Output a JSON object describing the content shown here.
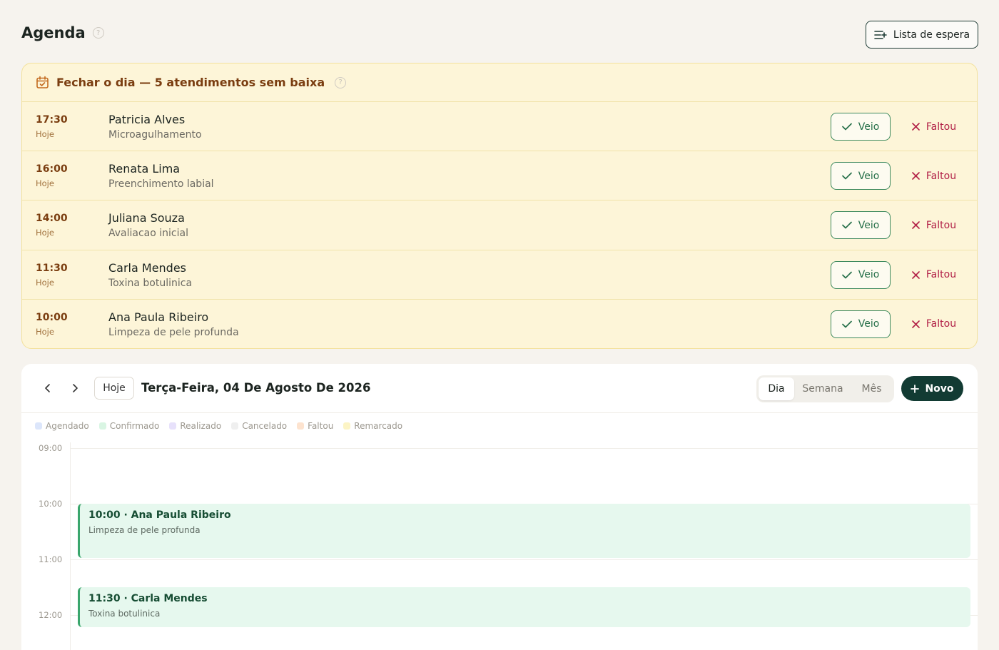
{
  "header": {
    "title": "Agenda",
    "help_glyph": "?",
    "waitlist_label": "Lista de espera"
  },
  "close_day": {
    "title": "Fechar o dia — 5 atendimentos sem baixa",
    "help_glyph": "?",
    "rows": [
      {
        "time": "17:30",
        "day": "Hoje",
        "client": "Patricia Alves",
        "service": "Microagulhamento",
        "yes_label": "Veio",
        "no_label": "Faltou"
      },
      {
        "time": "16:00",
        "day": "Hoje",
        "client": "Renata Lima",
        "service": "Preenchimento labial",
        "yes_label": "Veio",
        "no_label": "Faltou"
      },
      {
        "time": "14:00",
        "day": "Hoje",
        "client": "Juliana Souza",
        "service": "Avaliacao inicial",
        "yes_label": "Veio",
        "no_label": "Faltou"
      },
      {
        "time": "11:30",
        "day": "Hoje",
        "client": "Carla Mendes",
        "service": "Toxina botulinica",
        "yes_label": "Veio",
        "no_label": "Faltou"
      },
      {
        "time": "10:00",
        "day": "Hoje",
        "client": "Ana Paula Ribeiro",
        "service": "Limpeza de pele profunda",
        "yes_label": "Veio",
        "no_label": "Faltou"
      }
    ]
  },
  "calendar": {
    "today_label": "Hoje",
    "date_label": "Terça-Feira, 04 De Agosto De 2026",
    "views": [
      "Dia",
      "Semana",
      "Mês"
    ],
    "active_view": "Dia",
    "new_label": "Novo",
    "legend": [
      {
        "label": "Agendado",
        "color": "#dce6fb"
      },
      {
        "label": "Confirmado",
        "color": "#d9f5e3"
      },
      {
        "label": "Realizado",
        "color": "#e7e1fb"
      },
      {
        "label": "Cancelado",
        "color": "#efefef"
      },
      {
        "label": "Faltou",
        "color": "#fde3cf"
      },
      {
        "label": "Remarcado",
        "color": "#fcf4c5"
      }
    ],
    "hours": [
      "09:00",
      "10:00",
      "11:00",
      "12:00"
    ],
    "events": [
      {
        "title": "10:00 · Ana Paula Ribeiro",
        "subtitle": "Limpeza de pele profunda"
      },
      {
        "title": "11:30 · Carla Mendes",
        "subtitle": "Toxina botulinica"
      }
    ]
  },
  "colors": {
    "accent": "#123b33",
    "success": "#3e8a5e",
    "danger": "#b11f46",
    "warning_bg": "#fdf5d8"
  }
}
